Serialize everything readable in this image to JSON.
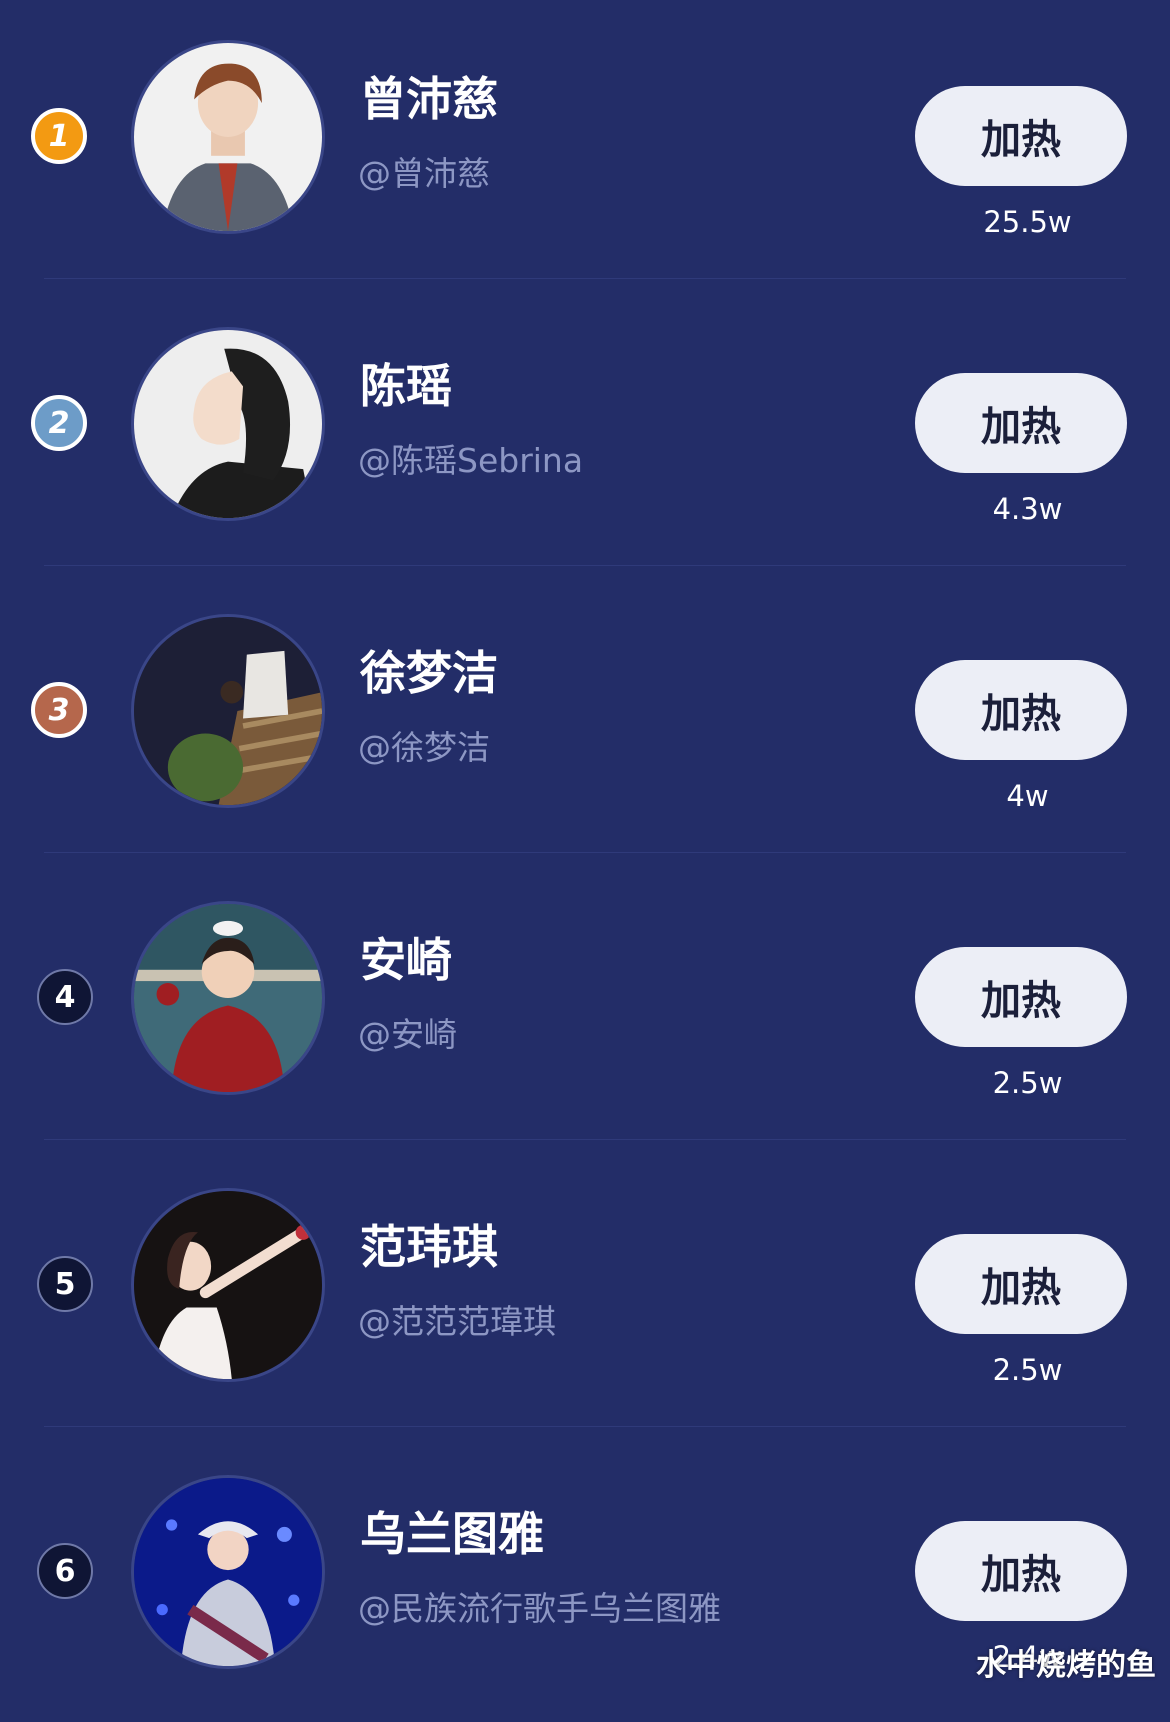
{
  "colors": {
    "background": "#232d68",
    "button_bg": "#eceef6",
    "rank_gold": "#f39a12",
    "rank_silver": "#6d9cc8",
    "rank_bronze": "#b5674c"
  },
  "items": [
    {
      "rank": "1",
      "name": "曾沛慈",
      "handle": "@曾沛慈",
      "button_label": "加热",
      "heat": "25.5w",
      "rank_color": "#f39a12"
    },
    {
      "rank": "2",
      "name": "陈瑶",
      "handle": "@陈瑶Sebrina",
      "button_label": "加热",
      "heat": "4.3w",
      "rank_color": "#6d9cc8"
    },
    {
      "rank": "3",
      "name": "徐梦洁",
      "handle": "@徐梦洁",
      "button_label": "加热",
      "heat": "4w",
      "rank_color": "#b5674c"
    },
    {
      "rank": "4",
      "name": "安崎",
      "handle": "@安崎",
      "button_label": "加热",
      "heat": "2.5w"
    },
    {
      "rank": "5",
      "name": "范玮琪",
      "handle": "@范范范瑋琪",
      "button_label": "加热",
      "heat": "2.5w"
    },
    {
      "rank": "6",
      "name": "乌兰图雅",
      "handle": "@民族流行歌手乌兰图雅",
      "button_label": "加热",
      "heat": "2.4w"
    }
  ],
  "watermark": "水中烧烤的鱼"
}
